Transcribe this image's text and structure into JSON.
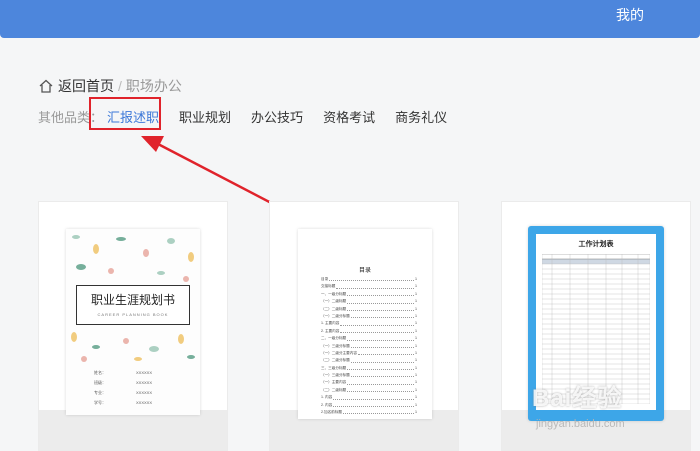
{
  "header": {
    "mine": "我的",
    "color": "#4d86dc"
  },
  "breadcrumb": {
    "home": "返回首页",
    "separator": "/",
    "current": "职场办公"
  },
  "categories": {
    "label": "其他品类：",
    "items": [
      "汇报述职",
      "职业规划",
      "办公技巧",
      "资格考试",
      "商务礼仪"
    ],
    "active_index": 0,
    "active_color": "#3c78d8"
  },
  "annotation": {
    "box_color": "#e0232b"
  },
  "cards": [
    {
      "title": "职业生涯规划书",
      "subtitle": "CAREER PLANNING BOOK",
      "fields": [
        [
          "姓名：",
          "XXXXXX",
          "班级：",
          "XXXXXX"
        ],
        [
          "专业：",
          "XXXXXX",
          "学号：",
          "XXXXXX"
        ]
      ]
    },
    {
      "title": "目录",
      "rows": [
        "目录",
        "交接标题",
        "一、一级分标题",
        "（一）二级标题",
        "（二）二级标题",
        "（一）二级分标题",
        "1. 主要内容",
        "2. 主要内容",
        "二、一级分标题",
        "（一）三级分标题",
        "（一）二级分主要内容",
        "（二）二级分标题",
        "三、三级分标题",
        "（一）三级分标题",
        "（一）主要内容",
        "（二）二级标题",
        "1. 内容",
        "2. 内容",
        "2.加名前标题"
      ]
    },
    {
      "title": "工作计划表",
      "frame_color": "#3da6e8"
    }
  ],
  "watermark": {
    "brand": "Bai经验",
    "url": "jingyan.baidu.com"
  }
}
